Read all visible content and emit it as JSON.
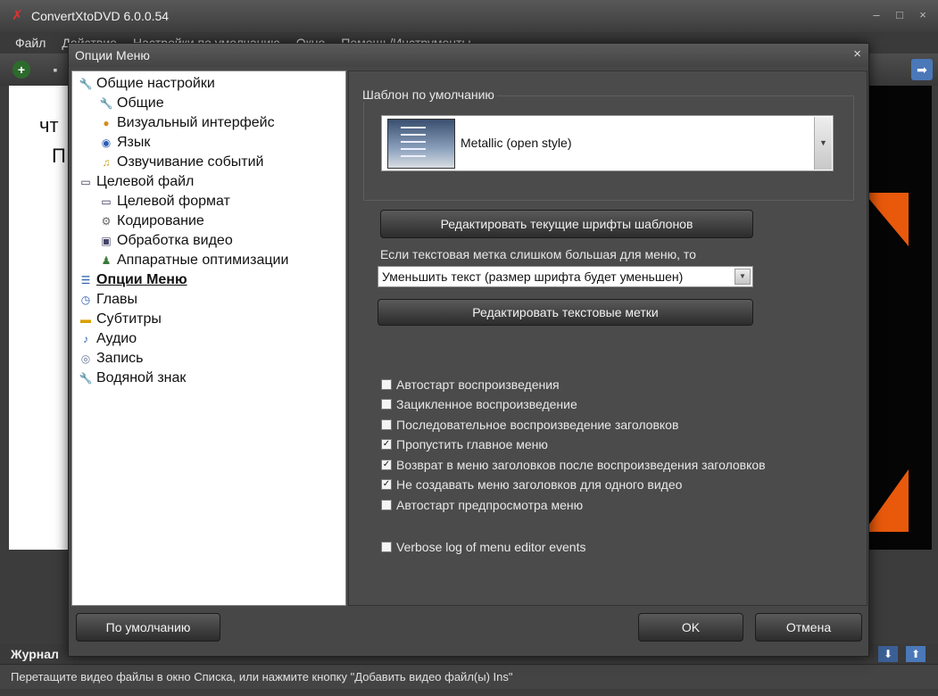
{
  "app": {
    "title": "ConvertXtoDVD 6.0.0.54",
    "menu": [
      "Файл",
      "Действие",
      "Настройки по умолчанию",
      "Окно",
      "Помощь/Инструменты"
    ],
    "list_hint_line1": "чт",
    "list_hint_line2": "П",
    "journal_label": "Журнал",
    "status_text": "Перетащите видео файлы в окно Списка, или нажмите кнопку \"Добавить видео файл(ы) Ins\""
  },
  "dialog": {
    "title": "Опции Меню",
    "close_glyph": "×",
    "tree": [
      {
        "label": "Общие настройки",
        "icon": "wrench-icon",
        "level": 0,
        "selected": false
      },
      {
        "label": "Общие",
        "icon": "wrench-icon",
        "level": 1,
        "selected": false
      },
      {
        "label": "Визуальный интерфейс",
        "icon": "palette-icon",
        "level": 1,
        "selected": false
      },
      {
        "label": "Язык",
        "icon": "globe-icon",
        "level": 1,
        "selected": false
      },
      {
        "label": "Озвучивание событий",
        "icon": "sound-icon",
        "level": 1,
        "selected": false
      },
      {
        "label": "Целевой файл",
        "icon": "monitor-icon",
        "level": 0,
        "selected": false
      },
      {
        "label": "Целевой формат",
        "icon": "monitor-icon",
        "level": 1,
        "selected": false
      },
      {
        "label": "Кодирование",
        "icon": "gear-icon",
        "level": 1,
        "selected": false
      },
      {
        "label": "Обработка видео",
        "icon": "video-icon",
        "level": 1,
        "selected": false
      },
      {
        "label": "Аппаратные оптимизации",
        "icon": "chip-icon",
        "level": 1,
        "selected": false
      },
      {
        "label": "Опции Меню",
        "icon": "menu-icon",
        "level": 0,
        "selected": true
      },
      {
        "label": "Главы",
        "icon": "clock-icon",
        "level": 0,
        "selected": false
      },
      {
        "label": "Субтитры",
        "icon": "speech-bubble-icon",
        "level": 0,
        "selected": false
      },
      {
        "label": "Аудио",
        "icon": "music-note-icon",
        "level": 0,
        "selected": false
      },
      {
        "label": "Запись",
        "icon": "disc-icon",
        "level": 0,
        "selected": false
      },
      {
        "label": "Водяной знак",
        "icon": "wrench-icon",
        "level": 0,
        "selected": false
      }
    ],
    "template_group_label": "Шаблон по умолчанию",
    "template_name": "Metallic (open style)",
    "edit_fonts_button": "Редактировать текущие шрифты шаблонов",
    "overflow_label": "Если текстовая метка слишком большая для меню, то",
    "overflow_select_value": "Уменьшить текст (размер шрифта будет уменьшен)",
    "edit_labels_button": "Редактировать текстовые метки",
    "checkboxes": [
      {
        "label": "Автостарт воспроизведения",
        "checked": false
      },
      {
        "label": "Зацикленное воспроизведение",
        "checked": false
      },
      {
        "label": "Последовательное воспроизведение заголовков",
        "checked": false
      },
      {
        "label": "Пропустить главное меню",
        "checked": true
      },
      {
        "label": "Возврат в меню заголовков после воспроизведения заголовков",
        "checked": true
      },
      {
        "label": "Не создавать меню заголовков для одного видео",
        "checked": true
      },
      {
        "label": "Автостарт предпросмотра меню",
        "checked": false
      },
      {
        "label": "Verbose log of menu editor events",
        "checked": false
      }
    ],
    "defaults_button": "По умолчанию",
    "ok_button": "OK",
    "cancel_button": "Отмена"
  }
}
